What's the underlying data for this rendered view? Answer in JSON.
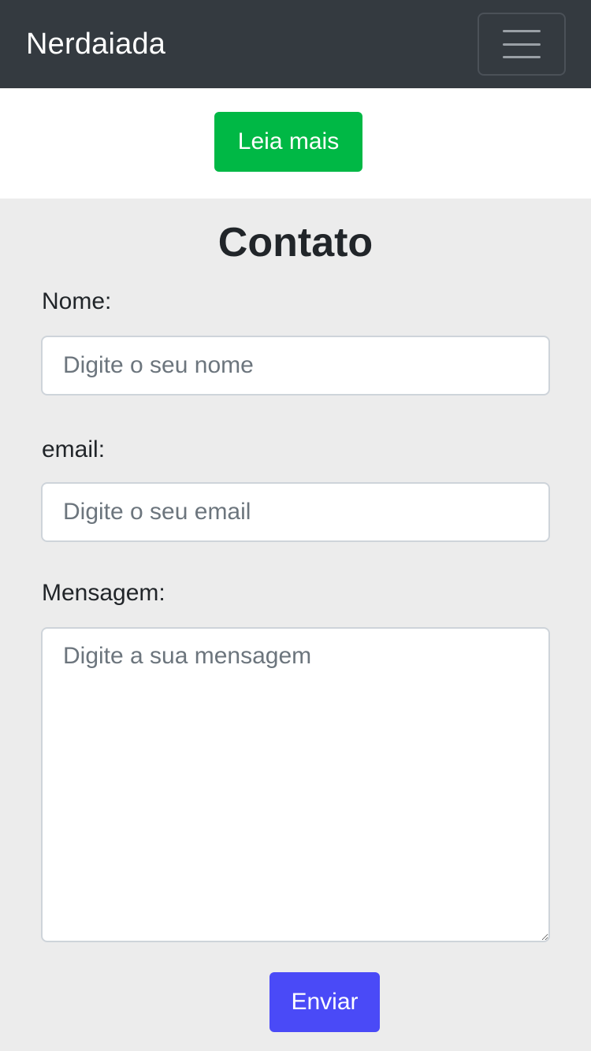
{
  "navbar": {
    "brand": "Nerdaiada",
    "toggler_icon": "hamburger-menu-icon",
    "background": "#343a40"
  },
  "hero": {
    "read_more_label": "Leia mais",
    "read_more_color": "#00b845"
  },
  "contact": {
    "title": "Contato",
    "name": {
      "label": "Nome:",
      "placeholder": "Digite o seu nome",
      "value": ""
    },
    "email": {
      "label": "email:",
      "placeholder": "Digite o seu email",
      "value": ""
    },
    "message": {
      "label": "Mensagem:",
      "placeholder": "Digite a sua mensagem",
      "value": ""
    },
    "submit_label": "Enviar",
    "submit_color": "#4a4af7",
    "background": "#ececec"
  }
}
